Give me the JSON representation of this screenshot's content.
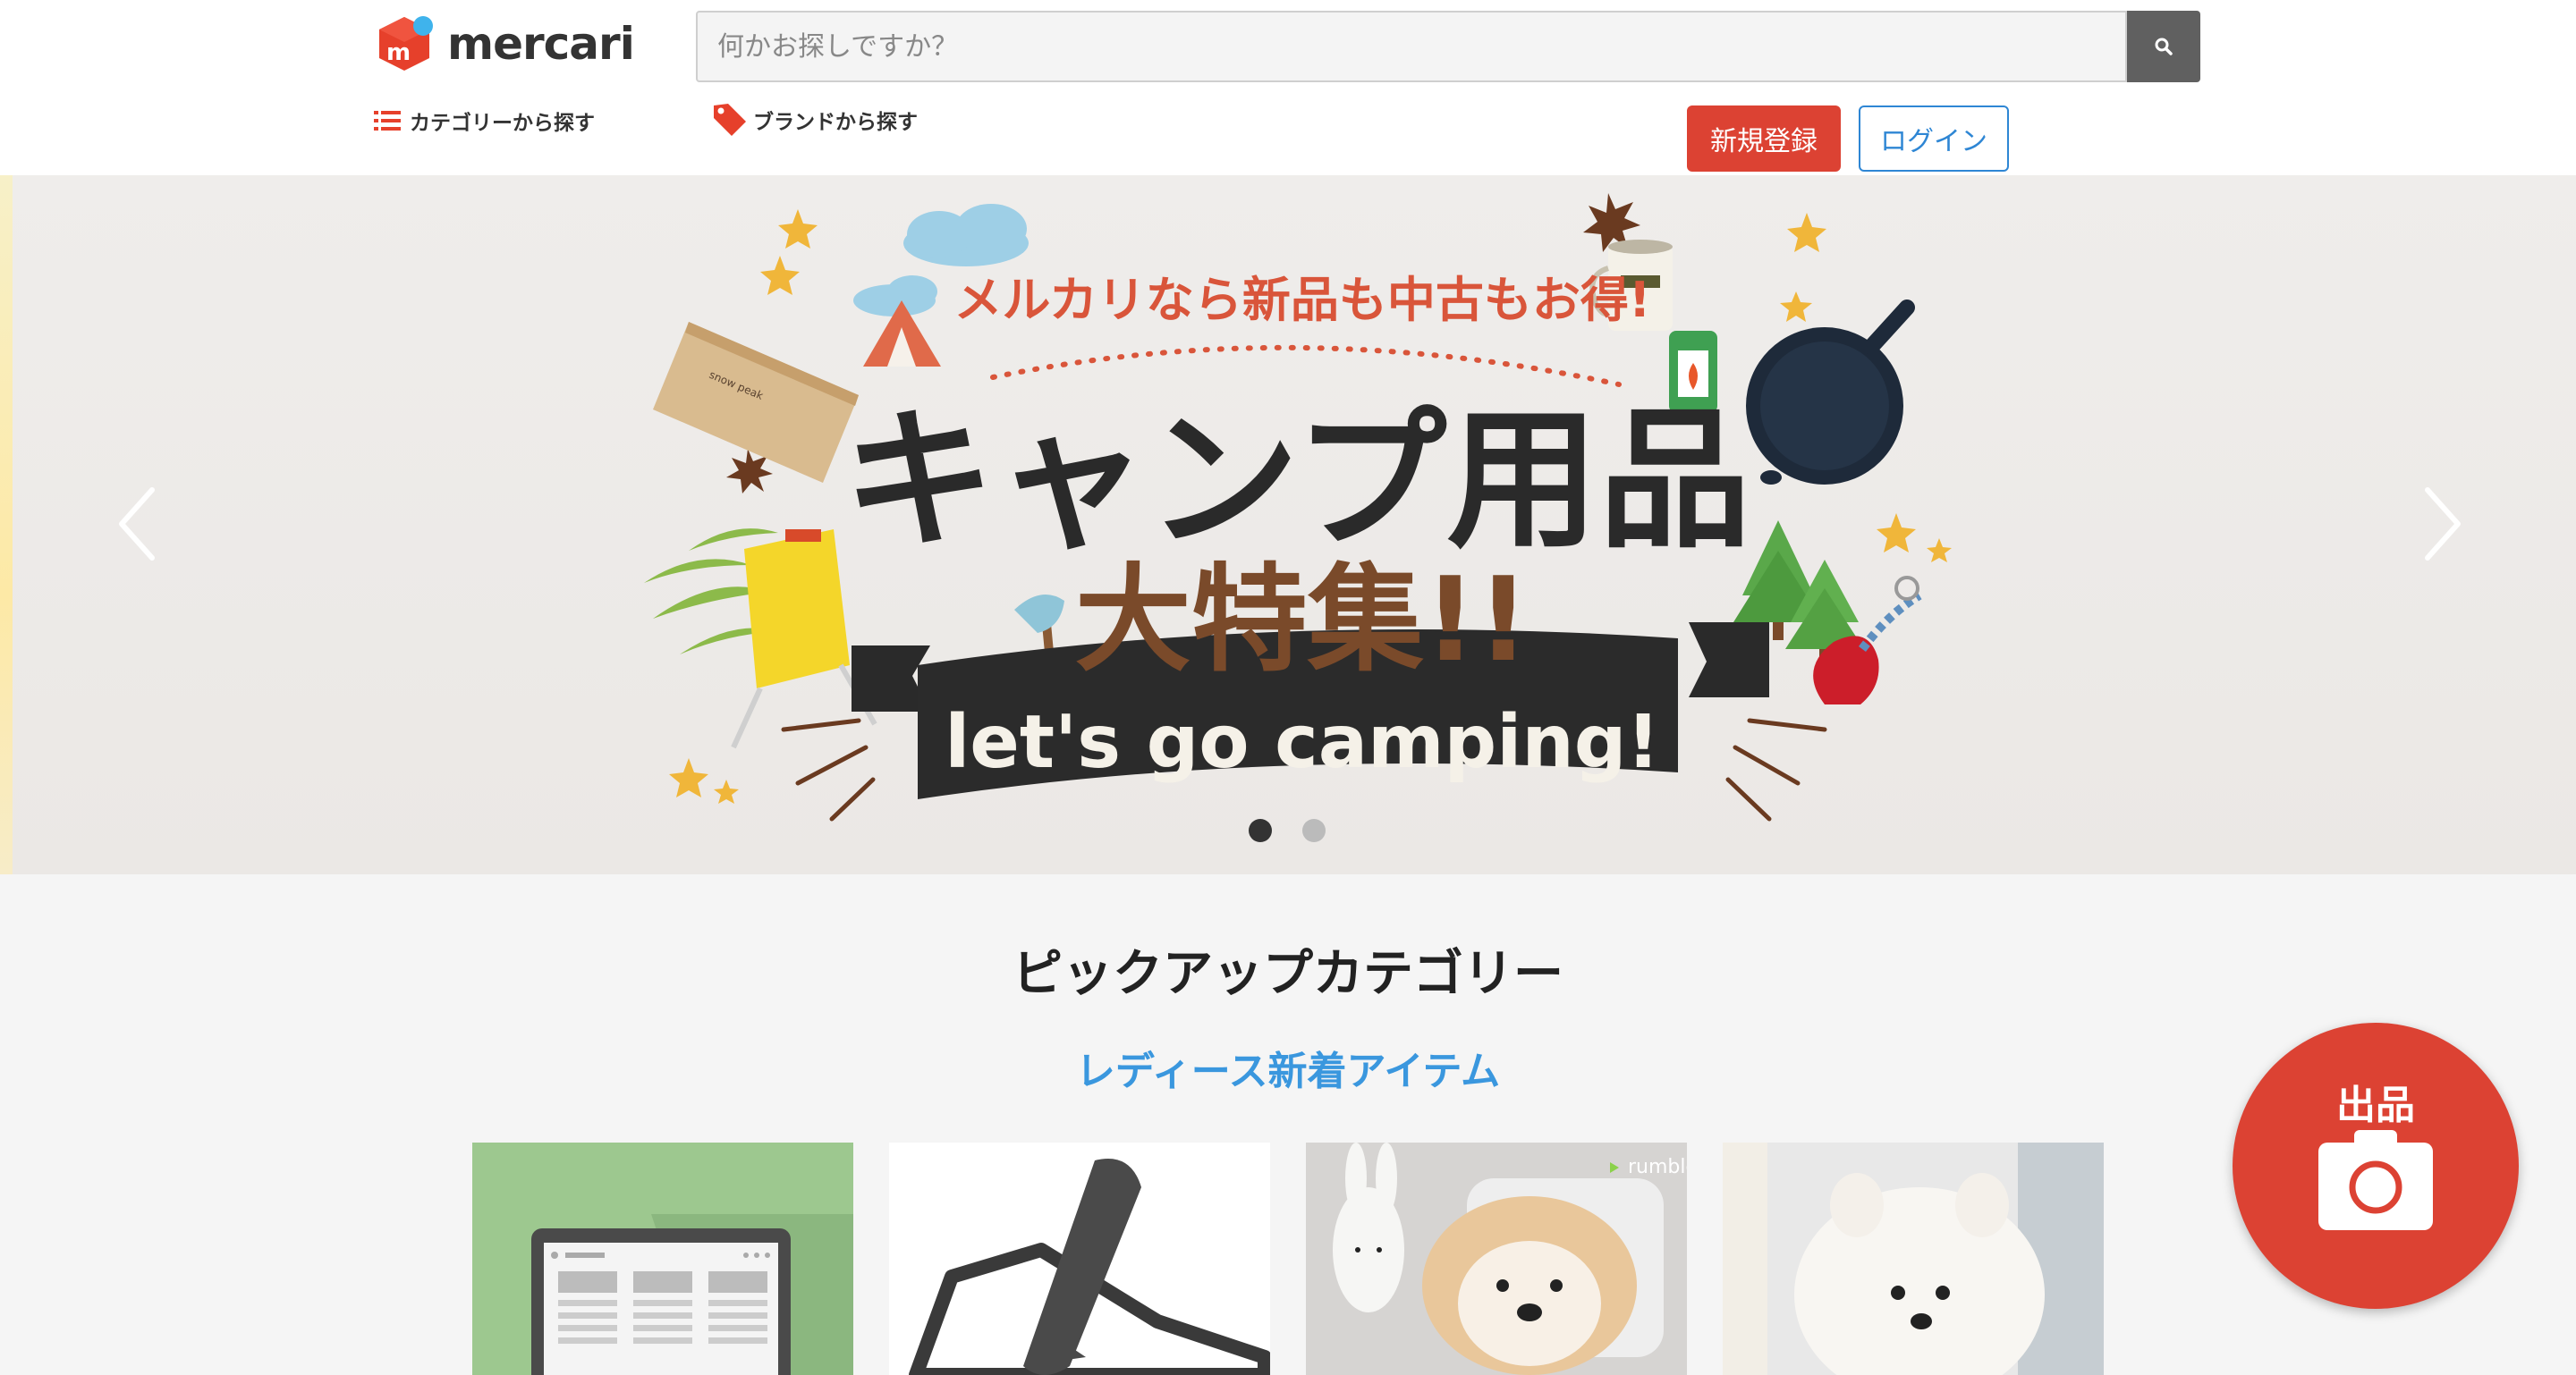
{
  "header": {
    "logo_text": "mercari",
    "search_placeholder": "何かお探しですか？",
    "nav": {
      "category": "カテゴリーから探す",
      "brand": "ブランドから探す"
    },
    "signup_label": "新規登録",
    "login_label": "ログイン"
  },
  "hero": {
    "headline_top": "メルカリなら新品も中古もお得!",
    "headline_main": "キャンプ用品",
    "headline_sub": "大特集!!",
    "ribbon_text": "let's go camping!",
    "brand_box_text": "snow peak",
    "slide_count": 2,
    "active_slide": 1
  },
  "pickup": {
    "title": "ピックアップカテゴリー",
    "subtitle": "レディース新着アイテム",
    "card_3_watermark": "rumble"
  },
  "sell_fab": {
    "label": "出品"
  },
  "colors": {
    "brand_red": "#dc4233",
    "link_blue": "#2e86d4",
    "subtitle_blue": "#3a97de"
  },
  "icons": {
    "search": "search-icon",
    "list": "list-icon",
    "tag": "tag-icon",
    "camera": "camera-icon",
    "chevron_left": "chevron-left-icon",
    "chevron_right": "chevron-right-icon"
  }
}
